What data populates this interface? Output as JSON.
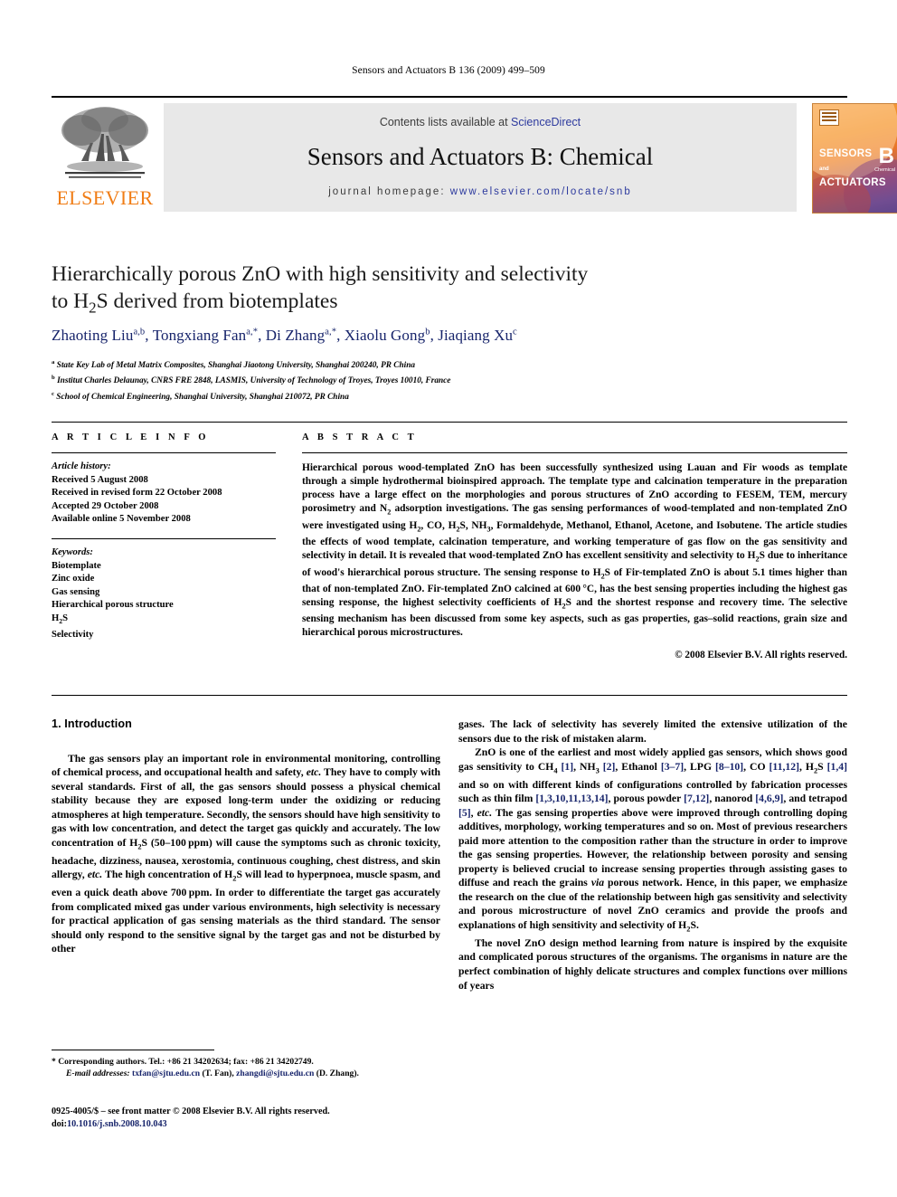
{
  "running_head": "Sensors and Actuators B 136 (2009) 499–509",
  "masthead": {
    "publisher_name": "ELSEVIER",
    "contents_prefix": "Contents lists available at ",
    "contents_link": "ScienceDirect",
    "journal_title": "Sensors and Actuators B: Chemical",
    "homepage_prefix": "journal homepage: ",
    "homepage_url": "www.elsevier.com/locate/snb",
    "cover": {
      "line1": "SENSORS",
      "and": "and",
      "line2": "ACTUATORS",
      "letter": "B",
      "subtitle": "Chemical"
    }
  },
  "article": {
    "title_line1": "Hierarchically porous ZnO with high sensitivity and selectivity",
    "title_line2_a": "to H",
    "title_line2_sub": "2",
    "title_line2_b": "S derived from biotemplates",
    "authors": [
      {
        "name": "Zhaoting Liu",
        "marks": "a,b",
        "sep": ", "
      },
      {
        "name": "Tongxiang Fan",
        "marks": "a,*",
        "sep": ", "
      },
      {
        "name": "Di Zhang",
        "marks": "a,*",
        "sep": ", "
      },
      {
        "name": "Xiaolu Gong",
        "marks": "b",
        "sep": ", "
      },
      {
        "name": "Jiaqiang Xu",
        "marks": "c",
        "sep": ""
      }
    ],
    "affiliations": [
      {
        "mark": "a",
        "text": "State Key Lab of Metal Matrix Composites, Shanghai Jiaotong University, Shanghai 200240, PR China"
      },
      {
        "mark": "b",
        "text": "Institut Charles Delaunay, CNRS FRE 2848, LASMIS, University of Technology of Troyes, Troyes 10010, France"
      },
      {
        "mark": "c",
        "text": "School of Chemical Engineering, Shanghai University, Shanghai 210072, PR China"
      }
    ]
  },
  "info": {
    "heading": "A R T I C L E    I N F O",
    "history_label": "Article history:",
    "history": [
      "Received 5 August 2008",
      "Received in revised form 22 October 2008",
      "Accepted 29 October 2008",
      "Available online 5 November 2008"
    ],
    "keywords_label": "Keywords:",
    "keywords": [
      "Biotemplate",
      "Zinc oxide",
      "Gas sensing",
      "Hierarchical porous structure",
      "H2S",
      "Selectivity"
    ]
  },
  "abstract": {
    "heading": "A B S T R A C T",
    "text": "Hierarchical porous wood-templated ZnO has been successfully synthesized using Lauan and Fir woods as template through a simple hydrothermal bioinspired approach. The template type and calcination temperature in the preparation process have a large effect on the morphologies and porous structures of ZnO according to FESEM, TEM, mercury porosimetry and N2 adsorption investigations. The gas sensing performances of wood-templated and non-templated ZnO were investigated using H2, CO, H2S, NH3, Formaldehyde, Methanol, Ethanol, Acetone, and Isobutene. The article studies the effects of wood template, calcination temperature, and working temperature of gas flow on the gas sensitivity and selectivity in detail. It is revealed that wood-templated ZnO has excellent sensitivity and selectivity to H2S due to inheritance of wood's hierarchical porous structure. The sensing response to H2S of Fir-templated ZnO is about 5.1 times higher than that of non-templated ZnO. Fir-templated ZnO calcined at 600 °C, has the best sensing properties including the highest gas sensing response, the highest selectivity coefficients of H2S and the shortest response and recovery time. The selective sensing mechanism has been discussed from some key aspects, such as gas properties, gas–solid reactions, grain size and hierarchical porous microstructures.",
    "copyright": "© 2008 Elsevier B.V. All rights reserved."
  },
  "body": {
    "section_heading": "1.  Introduction",
    "p1": "The gas sensors play an important role in environmental monitoring, controlling of chemical process, and occupational health and safety, etc. They have to comply with several standards. First of all, the gas sensors should possess a physical chemical stability because they are exposed long-term under the oxidizing or reducing atmospheres at high temperature. Secondly, the sensors should have high sensitivity to gas with low concentration, and detect the target gas quickly and accurately. The low concentration of H2S (50–100 ppm) will cause the symptoms such as chronic toxicity, headache, dizziness, nausea, xerostomia, continuous coughing, chest distress, and skin allergy, etc. The high concentration of H2S will lead to hyperpnoea, muscle spasm, and even a quick death above 700 ppm. In order to differentiate the target gas accurately from complicated mixed gas under various environments, high selectivity is necessary for practical application of gas sensing materials as the third standard. The sensor should only respond to the sensitive signal by the target gas and not be disturbed by other gases. The lack of selectivity has severely limited the extensive utilization of the sensors due to the risk of mistaken alarm.",
    "p2": "ZnO is one of the earliest and most widely applied gas sensors, which shows good gas sensitivity to CH4 [1], NH3 [2], Ethanol [3–7], LPG [8–10], CO [11,12], H2S [1,4] and so on with different kinds of configurations controlled by fabrication processes such as thin film [1,3,10,11,13,14], porous powder [7,12], nanorod [4,6,9], and tetrapod [5], etc. The gas sensing properties above were improved through controlling doping additives, morphology, working temperatures and so on. Most of previous researchers paid more attention to the composition rather than the structure in order to improve the gas sensing properties. However, the relationship between porosity and sensing property is believed crucial to increase sensing properties through assisting gases to diffuse and reach the grains via porous network. Hence, in this paper, we emphasize the research on the clue of the relationship between high gas sensitivity and selectivity and porous microstructure of novel ZnO ceramics and provide the proofs and explanations of high sensitivity and selectivity of H2S.",
    "p3": "The novel ZnO design method learning from nature is inspired by the exquisite and complicated porous structures of the organisms. The organisms in nature are the perfect combination of highly delicate structures and complex functions over millions of years"
  },
  "footer": {
    "corresponding": "*  Corresponding authors. Tel.: +86 21 34202634; fax: +86 21 34202749.",
    "email_label": "E-mail addresses:",
    "email1": "txfan@sjtu.edu.cn",
    "email1_who": " (T. Fan), ",
    "email2": "zhangdi@sjtu.edu.cn",
    "email2_who": " (D. Zhang).",
    "imprint": "0925-4005/$ – see front matter © 2008 Elsevier B.V. All rights reserved.",
    "doi_label": "doi:",
    "doi_value": "10.1016/j.snb.2008.10.043"
  },
  "colors": {
    "link": "#2d3a9e",
    "author": "#17246b",
    "elsevier_orange": "#F07D16",
    "band": "#e8e8e8"
  }
}
